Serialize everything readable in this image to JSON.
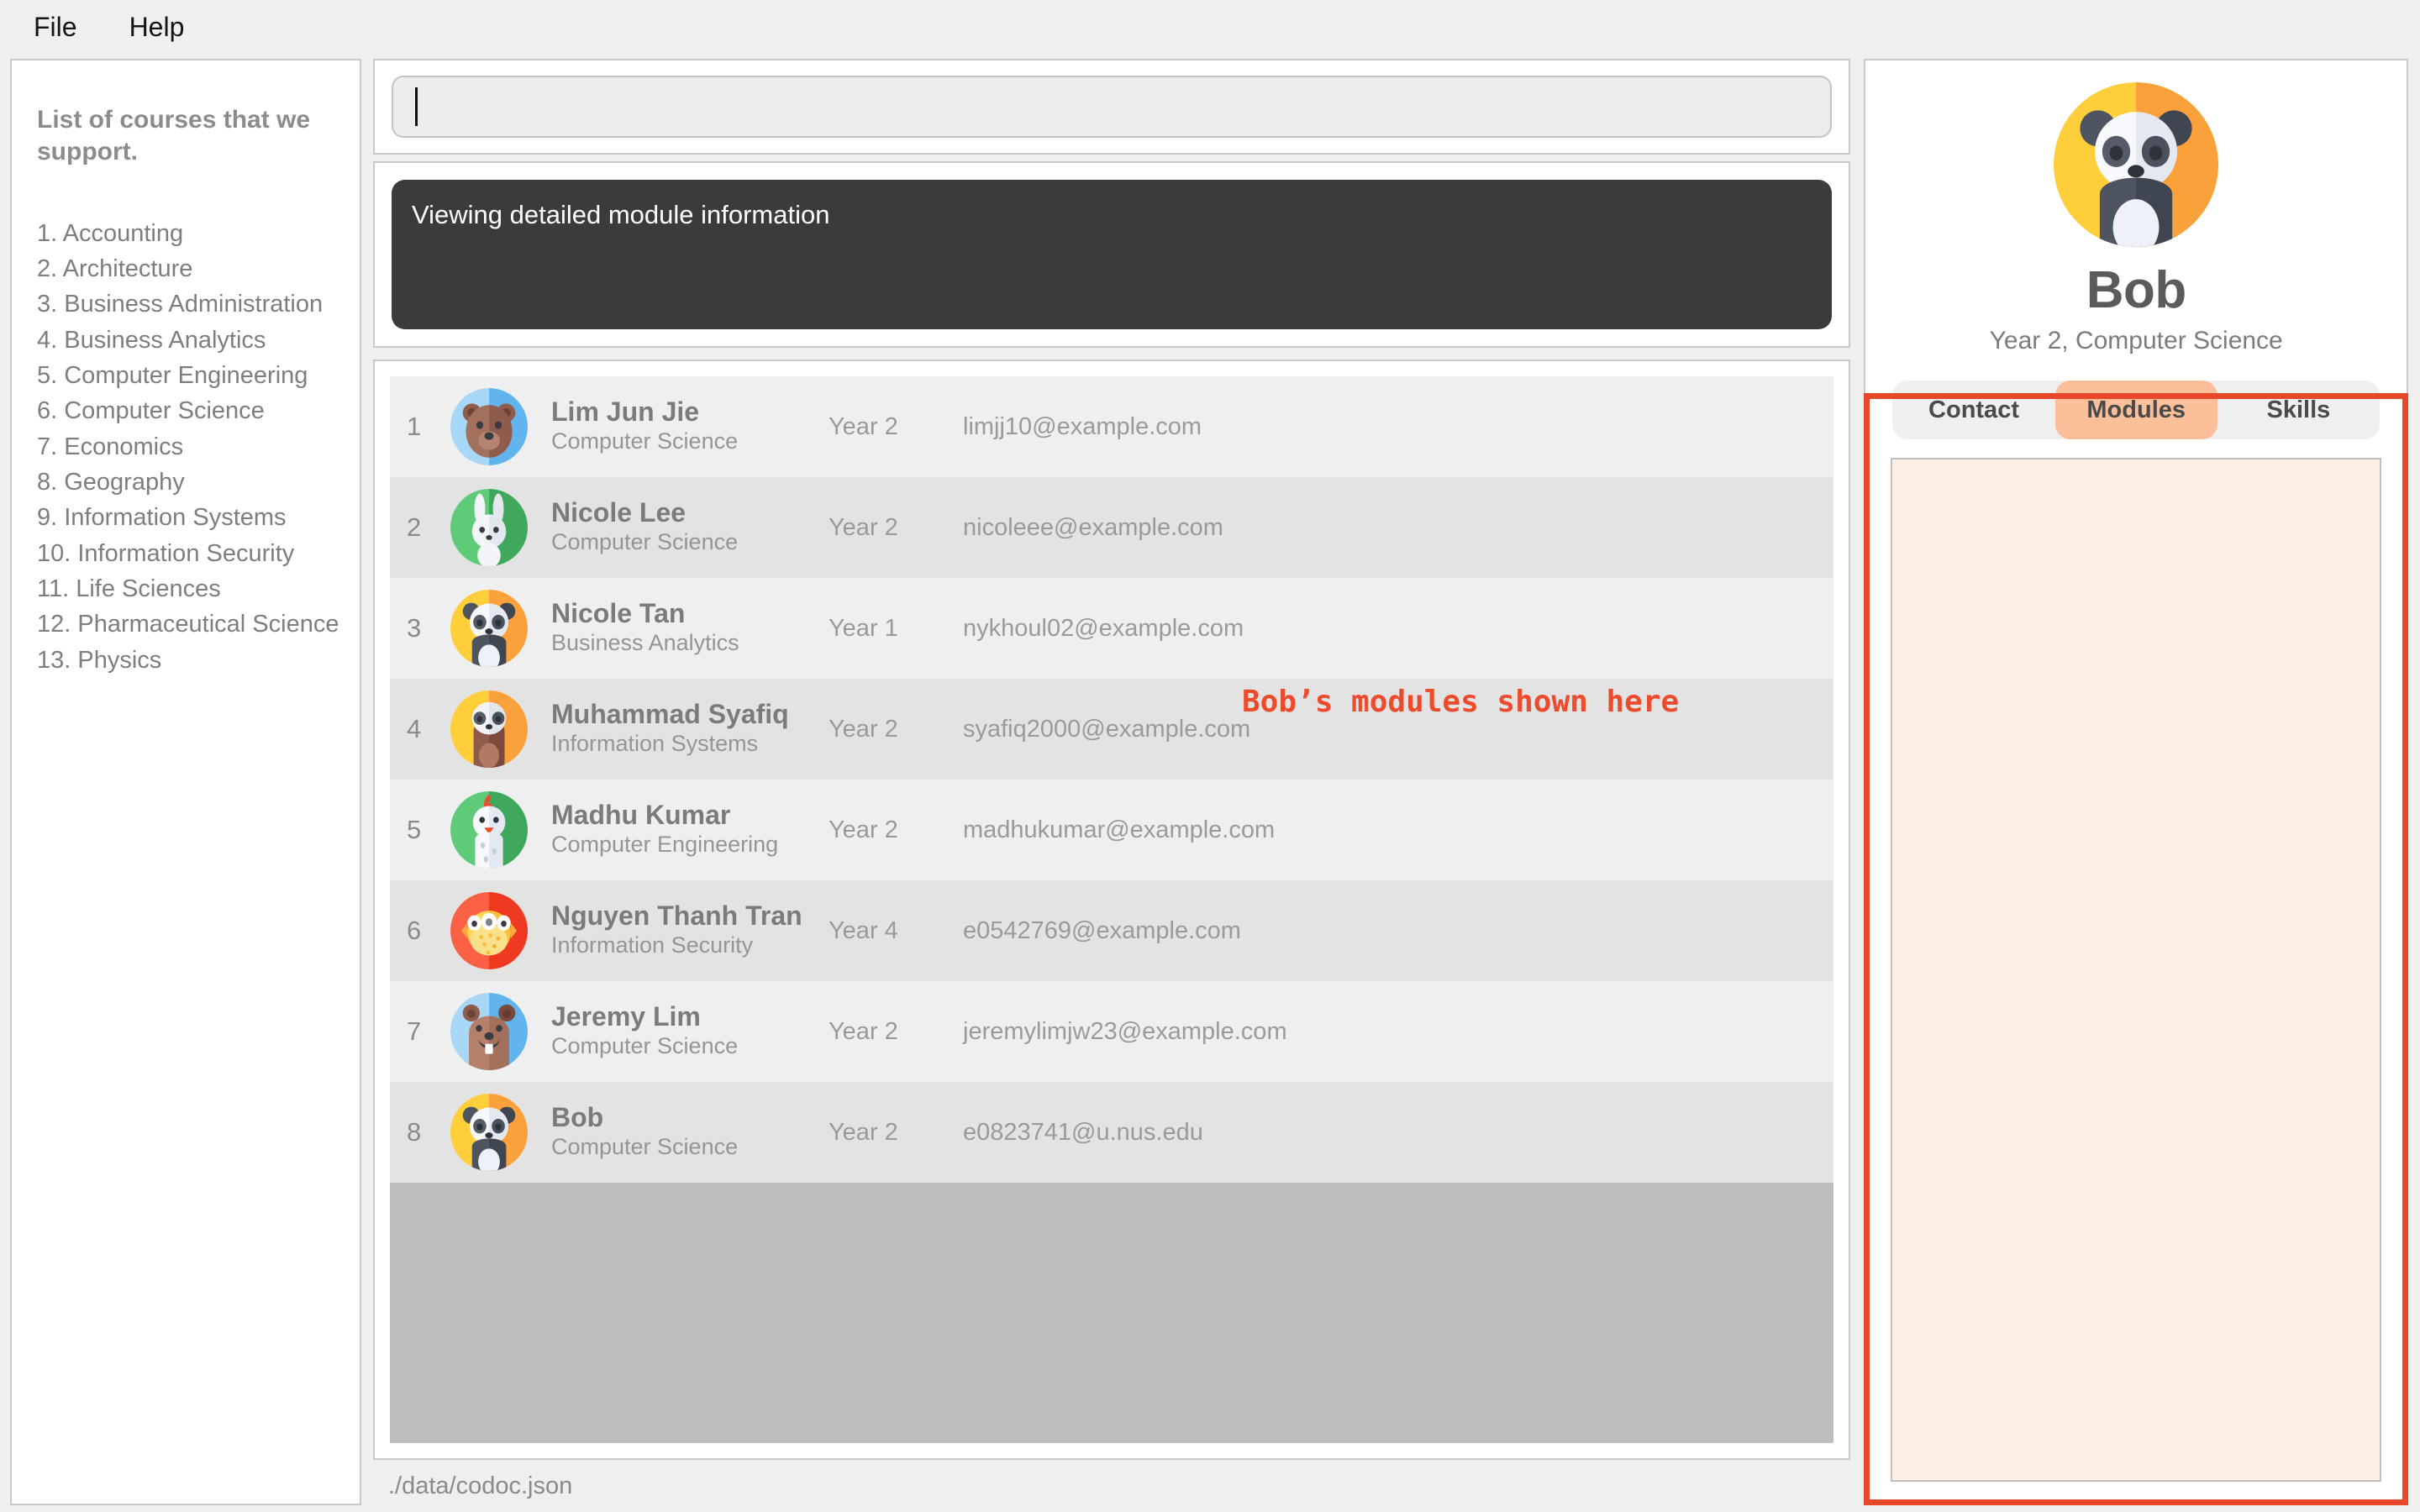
{
  "menubar": {
    "items": [
      {
        "label": "File"
      },
      {
        "label": "Help"
      }
    ]
  },
  "sidebar": {
    "title": "List of courses that we support.",
    "courses": [
      "1. Accounting",
      "2. Architecture",
      "3. Business Administration",
      "4. Business Analytics",
      "5. Computer Engineering",
      "6. Computer Science",
      "7. Economics",
      "8. Geography",
      "9. Information Systems",
      "10. Information Security",
      "11. Life Sciences",
      "12. Pharmaceutical Science",
      "13. Physics"
    ]
  },
  "search": {
    "value": "",
    "placeholder": ""
  },
  "status_box": {
    "text": "Viewing detailed module information"
  },
  "student_list": {
    "rows": [
      {
        "index": "1",
        "name": "Lim Jun Jie",
        "course": "Computer Science",
        "year": "Year 2",
        "email": "limjj10@example.com",
        "avatar": "bear-blue"
      },
      {
        "index": "2",
        "name": "Nicole Lee",
        "course": "Computer Science",
        "year": "Year 2",
        "email": "nicoleee@example.com",
        "avatar": "rabbit-green"
      },
      {
        "index": "3",
        "name": "Nicole Tan",
        "course": "Business Analytics",
        "year": "Year 1",
        "email": "nykhoul02@example.com",
        "avatar": "panda-yellow"
      },
      {
        "index": "4",
        "name": "Muhammad Syafiq",
        "course": "Information Systems",
        "year": "Year 2",
        "email": "syafiq2000@example.com",
        "avatar": "sloth-yellow"
      },
      {
        "index": "5",
        "name": "Madhu Kumar",
        "course": "Computer Engineering",
        "year": "Year 2",
        "email": "madhukumar@example.com",
        "avatar": "chicken-green"
      },
      {
        "index": "6",
        "name": "Nguyen Thanh Tran",
        "course": "Information Security",
        "year": "Year 4",
        "email": "e0542769@example.com",
        "avatar": "pufferfish-red"
      },
      {
        "index": "7",
        "name": "Jeremy Lim",
        "course": "Computer Science",
        "year": "Year 2",
        "email": "jeremylimjw23@example.com",
        "avatar": "beaver-blue"
      },
      {
        "index": "8",
        "name": "Bob",
        "course": "Computer Science",
        "year": "Year 2",
        "email": "e0823741@u.nus.edu",
        "avatar": "panda-yellow"
      }
    ]
  },
  "statusbar": {
    "path": "./data/codoc.json"
  },
  "profile": {
    "avatar": "panda-yellow",
    "name": "Bob",
    "subtitle": "Year 2, Computer Science",
    "tabs": [
      {
        "label": "Contact",
        "active": false
      },
      {
        "label": "Modules",
        "active": true
      },
      {
        "label": "Skills",
        "active": false
      }
    ],
    "tab_content": ""
  },
  "annotation": {
    "text": "Bob’s modules shown here",
    "color": "#ED4B2B"
  },
  "colors": {
    "accent": "#ED4B2B",
    "tab_active_bg": "#FBC09A",
    "tab_content_bg": "#FDEEE6",
    "status_box_bg": "#3B3B3B",
    "row_odd": "#EFEFEF",
    "row_even": "#E3E3E3",
    "list_empty": "#BEBEBE"
  }
}
